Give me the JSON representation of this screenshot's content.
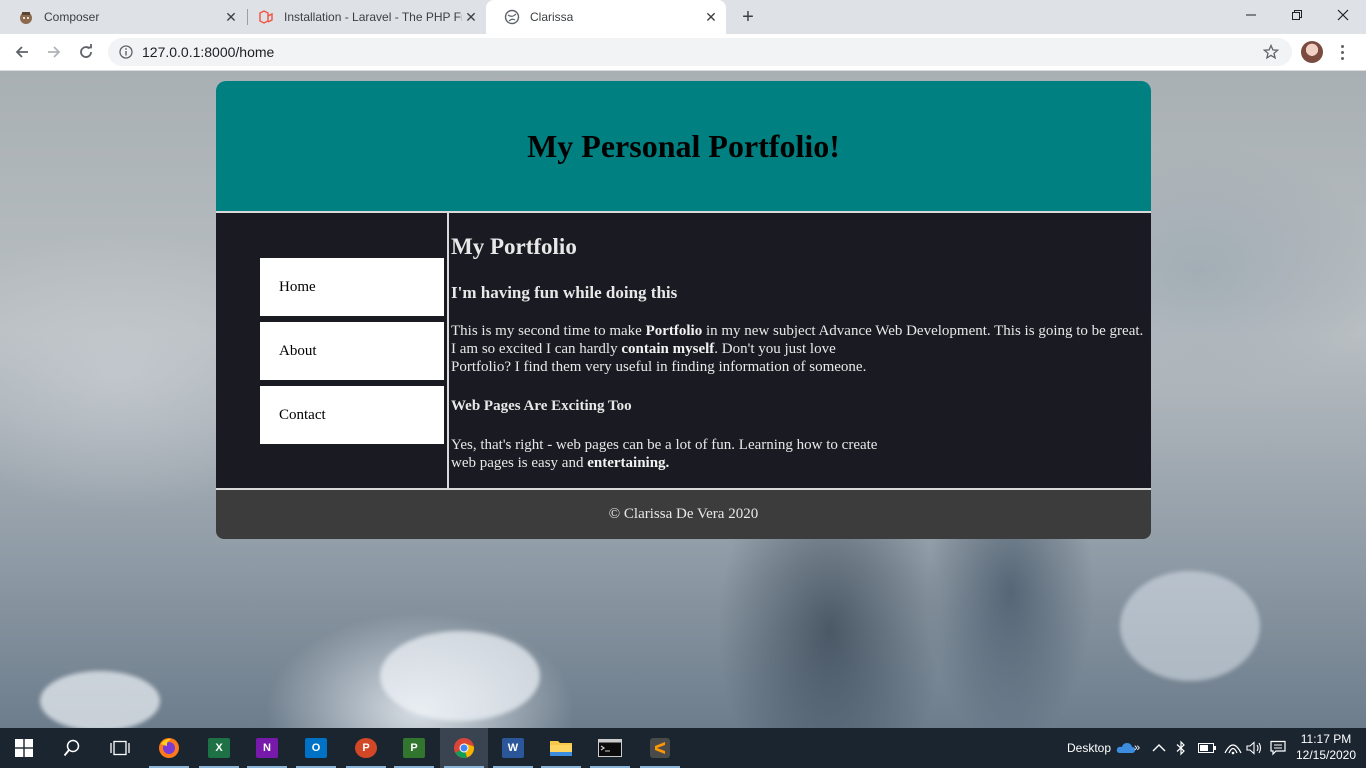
{
  "browser": {
    "tabs": [
      {
        "title": "Composer",
        "icon": "composer-icon",
        "active": false
      },
      {
        "title": "Installation - Laravel - The PHP Fr",
        "icon": "laravel-icon",
        "active": false
      },
      {
        "title": "Clarissa",
        "icon": "globe-icon",
        "active": true
      }
    ],
    "url": "127.0.0.1:8000/home"
  },
  "page": {
    "header_title": "My Personal Portfolio!",
    "nav": [
      {
        "label": "Home"
      },
      {
        "label": "About"
      },
      {
        "label": "Contact"
      }
    ],
    "content": {
      "heading": "My Portfolio",
      "subheading": "I'm having fun while doing this",
      "p1_a": "This is my second time to make ",
      "p1_b": "Portfolio",
      "p1_c": " in my new subject Advance Web Development. This is going to be great. I am so excited I can hardly ",
      "p1_d": "contain myself",
      "p1_e": ". Don't you just love",
      "p1_f": "Portfolio? I find them very useful in finding information of someone.",
      "section_title": "Web Pages Are Exciting Too",
      "p2_a": "Yes, that's right - web pages can be a lot of fun. Learning how to create",
      "p2_b": "web pages is easy and ",
      "p2_c": "entertaining."
    },
    "footer": "© Clarissa De Vera 2020"
  },
  "taskbar": {
    "apps": [
      "start-icon",
      "search-icon",
      "task-view-icon",
      "firefox-icon",
      "excel-icon",
      "onenote-icon",
      "outlook-icon",
      "powerpoint-icon",
      "project-icon",
      "chrome-icon",
      "word-icon",
      "file-explorer-icon",
      "terminal-icon",
      "sublime-text-icon"
    ],
    "desktop_label": "Desktop",
    "time": "11:17 PM",
    "date": "12/15/2020"
  }
}
